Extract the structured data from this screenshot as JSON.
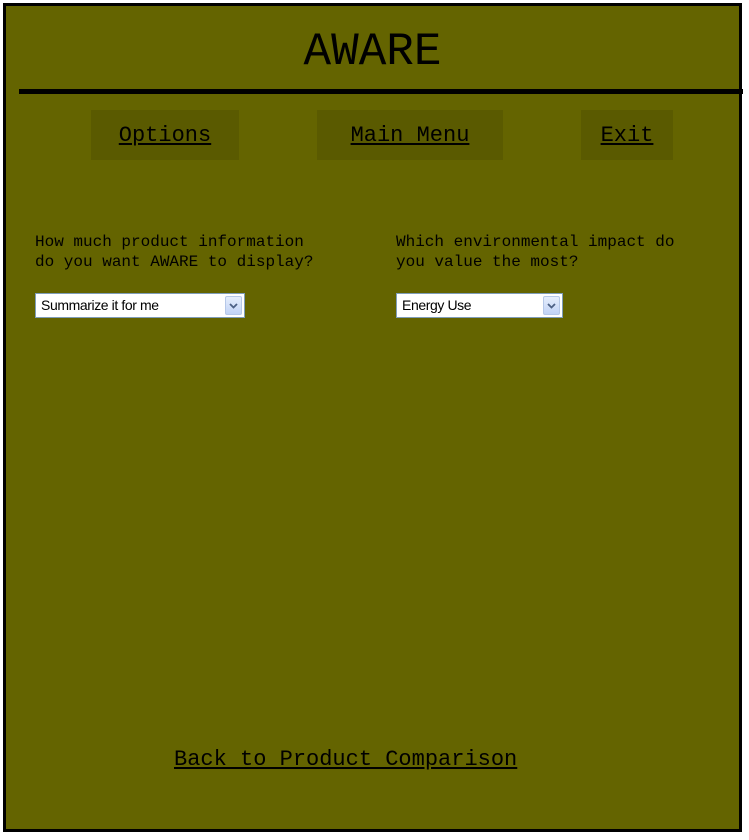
{
  "app": {
    "title": "AWARE"
  },
  "nav": {
    "options_label": "Options",
    "main_menu_label": "Main Menu",
    "exit_label": "Exit"
  },
  "settings": {
    "detail_question_line1": "How much product information",
    "detail_question_line2": "do you want AWARE to display?",
    "detail_select_value": "Summarize it for me",
    "impact_question_line1": "Which environmental impact do",
    "impact_question_line2": "you value the most?",
    "impact_select_value": "Energy Use"
  },
  "footer": {
    "back_link": "Back to Product Comparison"
  },
  "colors": {
    "background": "#646400",
    "button_background": "#5a5a00",
    "text": "#000000",
    "select_border": "#7f9db9"
  },
  "icons": {
    "select_arrow": "chevron-down-icon"
  }
}
